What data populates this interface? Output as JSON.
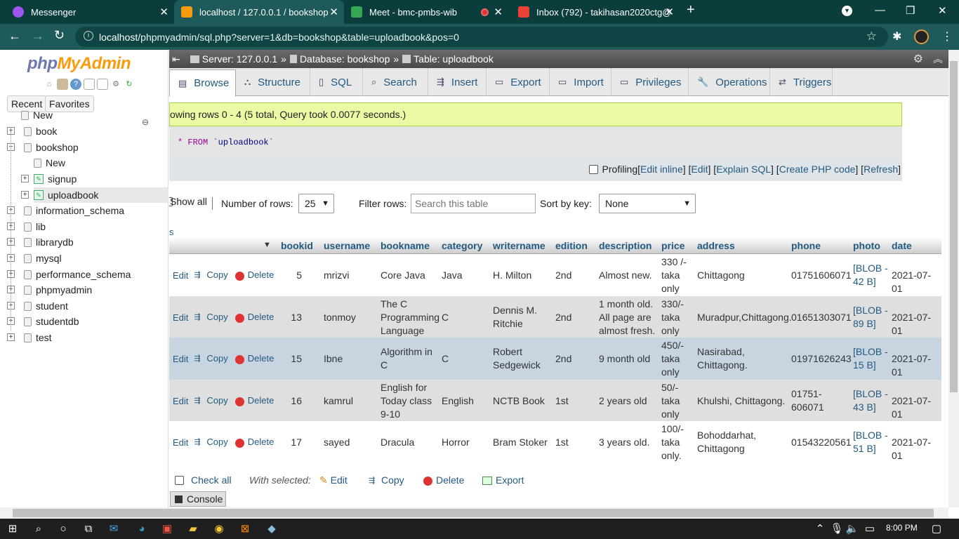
{
  "browser": {
    "tabs": [
      {
        "title": "Messenger",
        "color": "#a054f0"
      },
      {
        "title": "localhost / 127.0.0.1 / bookshop",
        "color": "#f89c0e"
      },
      {
        "title": "Meet - bmc-pmbs-wib",
        "color": "#34a853"
      },
      {
        "title": "Inbox (792) - takihasan2020ctg@",
        "color": "#ea4335"
      }
    ],
    "url_host": "localhost",
    "url_path": "/phpmyadmin/sql.php?server=1&db=bookshop&table=uploadbook&pos=0"
  },
  "sidebar": {
    "logo_php": "php",
    "logo_myadmin": "MyAdmin",
    "recent": "Recent",
    "favorites": "Favorites",
    "tree": [
      {
        "label": "New",
        "level": 1,
        "kind": "new"
      },
      {
        "label": "book",
        "level": 0,
        "kind": "db",
        "exp": "+"
      },
      {
        "label": "bookshop",
        "level": 0,
        "kind": "db",
        "exp": "−"
      },
      {
        "label": "New",
        "level": 2,
        "kind": "new"
      },
      {
        "label": "signup",
        "level": 2,
        "kind": "table",
        "exp": "+"
      },
      {
        "label": "uploadbook",
        "level": 2,
        "kind": "table",
        "exp": "+",
        "selected": true
      },
      {
        "label": "information_schema",
        "level": 0,
        "kind": "db",
        "exp": "+"
      },
      {
        "label": "lib",
        "level": 0,
        "kind": "db",
        "exp": "+"
      },
      {
        "label": "librarydb",
        "level": 0,
        "kind": "db",
        "exp": "+"
      },
      {
        "label": "mysql",
        "level": 0,
        "kind": "db",
        "exp": "+"
      },
      {
        "label": "performance_schema",
        "level": 0,
        "kind": "db",
        "exp": "+"
      },
      {
        "label": "phpmyadmin",
        "level": 0,
        "kind": "db",
        "exp": "+"
      },
      {
        "label": "student",
        "level": 0,
        "kind": "db",
        "exp": "+"
      },
      {
        "label": "studentdb",
        "level": 0,
        "kind": "db",
        "exp": "+"
      },
      {
        "label": "test",
        "level": 0,
        "kind": "db",
        "exp": "+"
      }
    ]
  },
  "breadcrumb": {
    "server": "Server: 127.0.0.1",
    "database": "Database: bookshop",
    "table": "Table: uploadbook",
    "sep": "»"
  },
  "tabs": [
    "Browse",
    "Structure",
    "SQL",
    "Search",
    "Insert",
    "Export",
    "Import",
    "Privileges",
    "Operations",
    "Triggers"
  ],
  "message": "owing rows 0 - 4 (5 total, Query took 0.0077 seconds.)",
  "sql": {
    "kw": "* FROM",
    "tbl": "`uploadbook`"
  },
  "sql_tools": {
    "profiling": "Profiling",
    "links": [
      "Edit inline",
      "Edit",
      "Explain SQL",
      "Create PHP code",
      "Refresh"
    ]
  },
  "nav": {
    "show_all": "Show all",
    "rows_label": "Number of rows:",
    "rows_value": "25",
    "filter_label": "Filter rows:",
    "filter_placeholder": "Search this table",
    "sort_label": "Sort by key:",
    "sort_value": "None",
    "stray": "s"
  },
  "columns": [
    "bookid",
    "username",
    "bookname",
    "category",
    "writername",
    "edition",
    "description",
    "price",
    "address",
    "phone",
    "photo",
    "date"
  ],
  "rows": [
    {
      "bookid": "5",
      "username": "mrizvi",
      "bookname": [
        "Core Java"
      ],
      "category": "Java",
      "writername": [
        "H. Milton"
      ],
      "edition": "2nd",
      "description": [
        "Almost new."
      ],
      "price": [
        "330 /-",
        "taka",
        "only"
      ],
      "address": [
        "Chittagong"
      ],
      "phone": [
        "01751606071"
      ],
      "photo": [
        "[BLOB -",
        "42 B]"
      ],
      "date": "2021-07-01"
    },
    {
      "bookid": "13",
      "username": "tonmoy",
      "bookname": [
        "The C",
        "Programming",
        "Language"
      ],
      "category": "C",
      "writername": [
        "Dennis M.",
        "Ritchie"
      ],
      "edition": "2nd",
      "description": [
        "1 month old.",
        "All page are",
        "almost fresh."
      ],
      "price": [
        "330/-",
        "taka",
        "only"
      ],
      "address": [
        "Muradpur,Chittagong."
      ],
      "phone": [
        "01651303071"
      ],
      "photo": [
        "[BLOB -",
        "89 B]"
      ],
      "date": "2021-07-01"
    },
    {
      "bookid": "15",
      "username": "Ibne",
      "bookname": [
        "Algorithm in",
        "C"
      ],
      "category": "C",
      "writername": [
        "Robert",
        "Sedgewick"
      ],
      "edition": "2nd",
      "description": [
        "9 month old"
      ],
      "price": [
        "450/-",
        "taka",
        "only"
      ],
      "address": [
        "Nasirabad,",
        "Chittagong."
      ],
      "phone": [
        "01971626243"
      ],
      "photo": [
        "[BLOB -",
        "15 B]"
      ],
      "date": "2021-07-01"
    },
    {
      "bookid": "16",
      "username": "kamrul",
      "bookname": [
        "English for",
        "Today class",
        "9-10"
      ],
      "category": "English",
      "writername": [
        "NCTB Book"
      ],
      "edition": "1st",
      "description": [
        "2 years old"
      ],
      "price": [
        "50/-",
        "taka",
        "only"
      ],
      "address": [
        "Khulshi, Chittagong."
      ],
      "phone": [
        "01751-",
        "606071"
      ],
      "photo": [
        "[BLOB -",
        "43 B]"
      ],
      "date": "2021-07-01"
    },
    {
      "bookid": "17",
      "username": "sayed",
      "bookname": [
        "Dracula"
      ],
      "category": "Horror",
      "writername": [
        "Bram Stoker"
      ],
      "edition": "1st",
      "description": [
        "3 years old."
      ],
      "price": [
        "100/-",
        "taka",
        "only."
      ],
      "address": [
        "Bohoddarhat,",
        "Chittagong"
      ],
      "phone": [
        "01543220561"
      ],
      "photo": [
        "[BLOB -",
        "51 B]"
      ],
      "date": "2021-07-01"
    }
  ],
  "row_actions": {
    "edit": "Edit",
    "copy": "Copy",
    "delete": "Delete"
  },
  "footer": {
    "check_all": "Check all",
    "with_selected": "With selected:",
    "edit": "Edit",
    "copy": "Copy",
    "delete": "Delete",
    "export": "Export"
  },
  "console": "Console",
  "taskbar": {
    "time": "8:00 PM"
  }
}
